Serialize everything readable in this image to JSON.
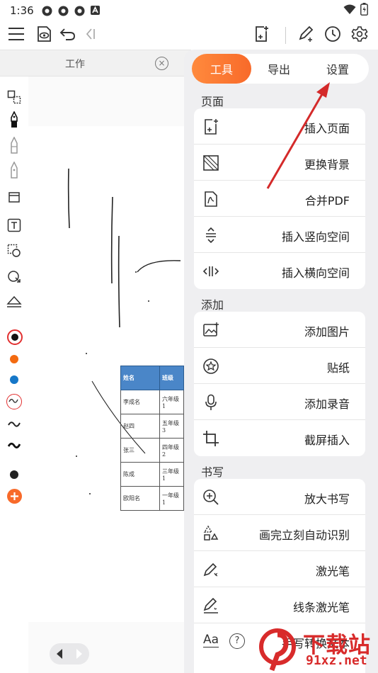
{
  "status_bar": {
    "time": "1:36"
  },
  "document": {
    "tab_title": "工作",
    "close_symbol": "×",
    "table": {
      "headers": [
        "姓名",
        "班级"
      ],
      "rows": [
        [
          "李成名",
          "六年级1"
        ],
        [
          "赵四",
          "五年级3"
        ],
        [
          "张三",
          "四年级2"
        ],
        [
          "陈成",
          "三年级1"
        ],
        [
          "欧阳名",
          "一年级1"
        ]
      ]
    }
  },
  "pen_colors": [
    "#111111",
    "#f36a10",
    "#1677c8"
  ],
  "panel": {
    "tabs": [
      "工具",
      "导出",
      "设置"
    ],
    "active_tab": "工具",
    "sections": [
      {
        "title": "页面",
        "items": [
          {
            "label": "插入页面",
            "icon": "insert-page-icon"
          },
          {
            "label": "更换背景",
            "icon": "background-icon"
          },
          {
            "label": "合并PDF",
            "icon": "pdf-icon"
          },
          {
            "label": "插入竖向空间",
            "icon": "vertical-space-icon"
          },
          {
            "label": "插入横向空间",
            "icon": "horizontal-space-icon"
          }
        ]
      },
      {
        "title": "添加",
        "items": [
          {
            "label": "添加图片",
            "icon": "image-icon"
          },
          {
            "label": "贴纸",
            "icon": "sticker-icon"
          },
          {
            "label": "添加录音",
            "icon": "microphone-icon"
          },
          {
            "label": "截屏插入",
            "icon": "crop-icon"
          }
        ]
      },
      {
        "title": "书写",
        "items": [
          {
            "label": "放大书写",
            "icon": "zoom-write-icon"
          },
          {
            "label": "画完立刻自动识别",
            "icon": "shape-recognize-icon"
          },
          {
            "label": "激光笔",
            "icon": "laser-pen-icon"
          },
          {
            "label": "线条激光笔",
            "icon": "line-laser-pen-icon"
          },
          {
            "label": "手写转换文本",
            "icon": "text-convert-icon",
            "help": "?",
            "prefix": "Aa"
          }
        ]
      }
    ]
  },
  "watermark": {
    "title": "下载站",
    "url": "91xz.net"
  },
  "colors": {
    "accent": "#f86a2a",
    "arrow": "#d42a2a",
    "table_header": "#4a86c8"
  }
}
